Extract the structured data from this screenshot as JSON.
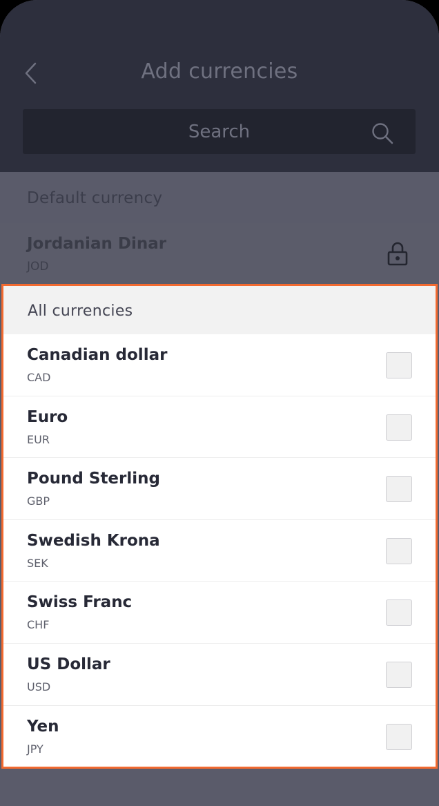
{
  "header": {
    "title": "Add currencies",
    "back_icon": "chevron-left-icon"
  },
  "search": {
    "placeholder": "Search",
    "icon": "search-icon"
  },
  "default_section": {
    "label": "Default currency",
    "currency": {
      "name": "Jordanian Dinar",
      "code": "JOD",
      "icon": "lock-icon"
    }
  },
  "all_section": {
    "label": "All currencies",
    "items": [
      {
        "name": "Canadian dollar",
        "code": "CAD",
        "checked": false
      },
      {
        "name": "Euro",
        "code": "EUR",
        "checked": false
      },
      {
        "name": "Pound Sterling",
        "code": "GBP",
        "checked": false
      },
      {
        "name": "Swedish Krona",
        "code": "SEK",
        "checked": false
      },
      {
        "name": "Swiss Franc",
        "code": "CHF",
        "checked": false
      },
      {
        "name": "US Dollar",
        "code": "USD",
        "checked": false
      },
      {
        "name": "Yen",
        "code": "JPY",
        "checked": false
      }
    ]
  },
  "colors": {
    "header_bg": "#2d2f3d",
    "overlay_bg": "#5a5b6a",
    "highlight_border": "#f26a30"
  }
}
